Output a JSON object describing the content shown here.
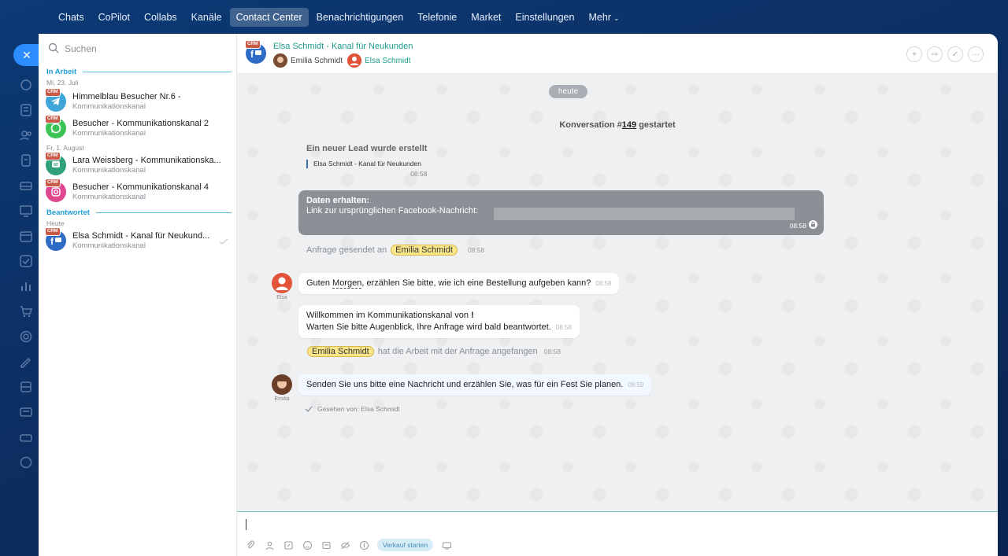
{
  "topnav": {
    "items": [
      "Chats",
      "CoPilot",
      "Collabs",
      "Kanäle",
      "Contact Center",
      "Benachrichtigungen",
      "Telefonie",
      "Market",
      "Einstellungen",
      "Mehr"
    ],
    "active_index": 4
  },
  "sidebar": {
    "search_placeholder": "Suchen",
    "group_in_progress": "In Arbeit",
    "group_answered": "Beantwortet",
    "chats": [
      {
        "date": "Mi, 23. Juli",
        "title": "Himmelblau Besucher Nr.6 -",
        "subtitle": "Kommunikationskanal",
        "channel": "telegram-icon",
        "color": "#3ea6d9"
      },
      {
        "title": "Besucher - Kommunikationskanal 2",
        "subtitle": "Kommunikationskanal",
        "channel": "whatsapp-icon",
        "color": "#3cc356"
      },
      {
        "date": "Fr, 1. August",
        "title": "Lara Weissberg - Kommunikationska...",
        "subtitle": "Kommunikationskanal",
        "channel": "livechat-icon",
        "color": "#2fa07a"
      },
      {
        "title": "Besucher - Kommunikationskanal 4",
        "subtitle": "Kommunikationskanal",
        "channel": "instagram-icon",
        "color": "#e0478f"
      }
    ],
    "answered": [
      {
        "date": "Heute",
        "title": "Elsa Schmidt - Kanal für Neukund...",
        "subtitle": "Kommunikationskanal",
        "channel": "facebook-icon",
        "color": "#2e6bc5"
      }
    ],
    "crm_badge": "CRM"
  },
  "header": {
    "title": "Elsa Schmidt - Kanal für Neukunden",
    "member_1": "Emilia Schmidt",
    "member_2": "Elsa Schmidt"
  },
  "messages": {
    "day_pill": "heute",
    "conv_prefix": "Konversation #",
    "conv_number": "149",
    "conv_suffix": " gestartet",
    "lead_title": "Ein neuer Lead wurde erstellt",
    "lead_quote": "Elsa Schmidt - Kanal für Neukunden",
    "lead_time": "08:58",
    "data_title": "Daten erhalten:",
    "data_text": "Link zur ursprünglichen Facebook-Nachricht:",
    "data_time": "08:58",
    "request_sent_prefix": "Anfrage gesendet an",
    "request_sent_name": "Emilia Schmidt",
    "request_sent_time": "08:58",
    "msg1_pre": "Guten ",
    "msg1_underlined": "Morgen",
    "msg1_post": ", erzählen Sie bitte, wie ich eine Bestellung aufgeben kann?",
    "msg1_time": "08:58",
    "msg1_author": "Elsa",
    "msg2_line1_pre": "Willkommen im Kommunikationskanal von ",
    "msg2_line1_bold": "!",
    "msg2_line2": "Warten Sie bitte Augenblick, Ihre Anfrage wird bald beantwortet.",
    "msg2_time": "08:58",
    "work_started_name": "Emilia Schmidt",
    "work_started_text": "hat die Arbeit mit der Anfrage angefangen",
    "work_started_time": "08:58",
    "msg3_text": "Senden Sie uns bitte eine Nachricht und erzählen Sie, was für ein Fest Sie planen.",
    "msg3_time": "08:59",
    "msg3_author": "Emilia",
    "seen": "Gesehen von: Elsa Schmidt"
  },
  "composer": {
    "value": "",
    "sale_button": "Verkauf starten"
  }
}
